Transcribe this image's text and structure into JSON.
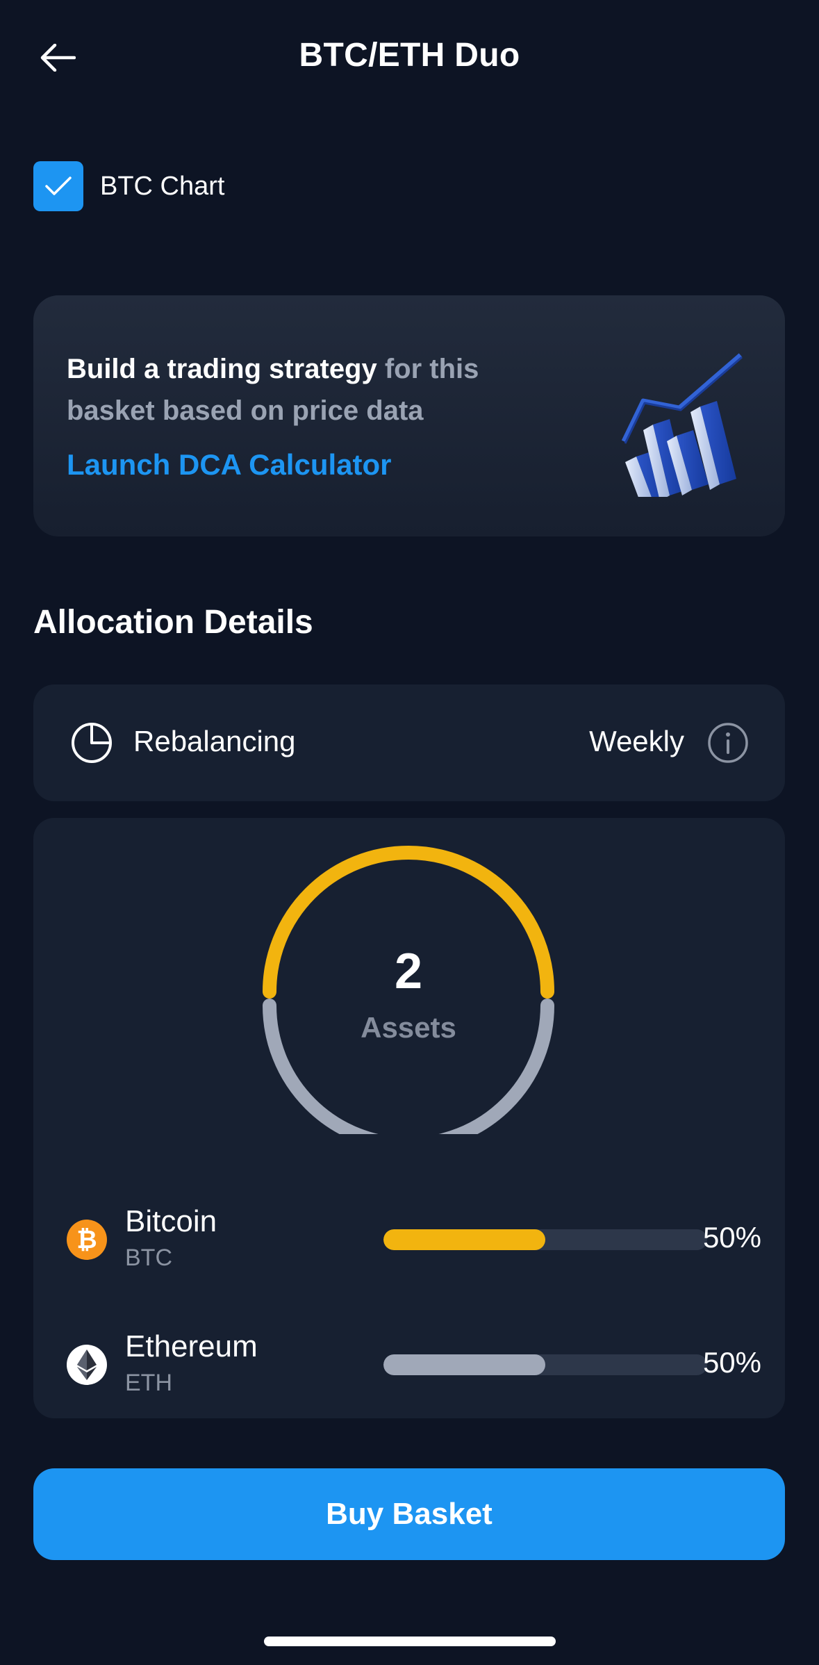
{
  "header": {
    "title": "BTC/ETH Duo",
    "back_icon": "arrow-left-icon"
  },
  "chart_toggle": {
    "label": "BTC Chart",
    "checked": true,
    "color": "#1d95f2"
  },
  "promo": {
    "title_strong": "Build a trading strategy",
    "title_rest": " for this basket based on price data",
    "link": "Launch DCA Calculator",
    "illustration": "bar-chart-3d-icon"
  },
  "allocation": {
    "title": "Allocation Details",
    "rebalancing": {
      "label": "Rebalancing",
      "value": "Weekly",
      "icon": "pie-clock-icon",
      "info_icon": "info-icon"
    },
    "summary": {
      "count": "2",
      "label": "Assets"
    },
    "assets": [
      {
        "name": "Bitcoin",
        "ticker": "BTC",
        "percent": "50%",
        "fraction": 0.5,
        "color": "#f2b40f",
        "icon_bg": "#f7931a"
      },
      {
        "name": "Ethereum",
        "ticker": "ETH",
        "percent": "50%",
        "fraction": 0.5,
        "color": "#a0a8b8",
        "icon_bg": "#ffffff"
      }
    ]
  },
  "actions": {
    "buy_label": "Buy Basket"
  },
  "colors": {
    "background": "#0d1424",
    "card": "#172031",
    "accent": "#1d95f2"
  }
}
